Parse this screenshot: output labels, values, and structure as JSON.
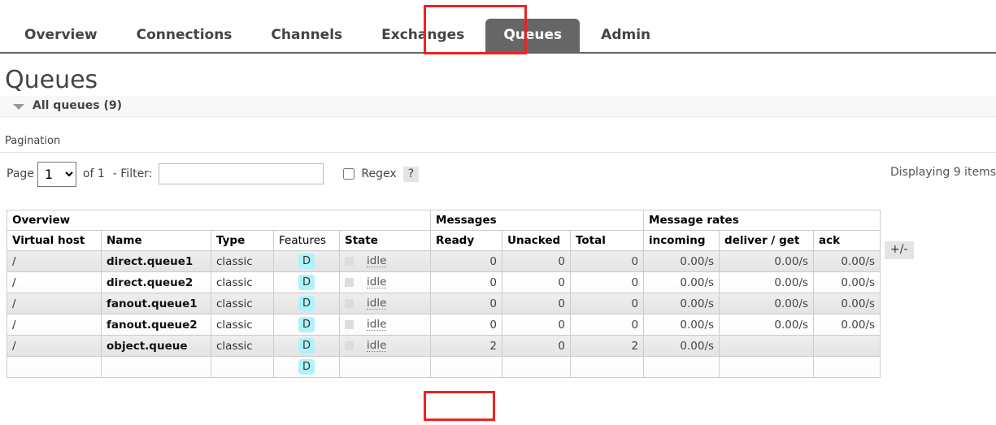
{
  "nav": {
    "items": [
      {
        "label": "Overview",
        "active": false
      },
      {
        "label": "Connections",
        "active": false
      },
      {
        "label": "Channels",
        "active": false
      },
      {
        "label": "Exchanges",
        "active": false
      },
      {
        "label": "Queues",
        "active": true
      },
      {
        "label": "Admin",
        "active": false
      }
    ]
  },
  "page": {
    "title": "Queues",
    "section_header": "All queues (9)",
    "pagination_label": "Pagination"
  },
  "pagination": {
    "page_label": "Page",
    "page_value": "1",
    "page_options": [
      "1"
    ],
    "of_label": "of 1",
    "filter_label": "- Filter:",
    "filter_value": "",
    "filter_placeholder": "",
    "regex_label": "Regex",
    "regex_checked": false,
    "help_label": "?",
    "displaying": "Displaying 9 items"
  },
  "table": {
    "group_headers": [
      {
        "label": "Overview",
        "span": 5
      },
      {
        "label": "Messages",
        "span": 3
      },
      {
        "label": "Message rates",
        "span": 3
      }
    ],
    "plusminus_label": "+/-",
    "columns": [
      {
        "label": "Virtual host",
        "sortable": true,
        "align": "left"
      },
      {
        "label": "Name",
        "sortable": true,
        "align": "left"
      },
      {
        "label": "Type",
        "sortable": true,
        "align": "left"
      },
      {
        "label": "Features",
        "sortable": false,
        "align": "left"
      },
      {
        "label": "State",
        "sortable": true,
        "align": "left"
      },
      {
        "label": "Ready",
        "sortable": true,
        "align": "left"
      },
      {
        "label": "Unacked",
        "sortable": true,
        "align": "left"
      },
      {
        "label": "Total",
        "sortable": true,
        "align": "left"
      },
      {
        "label": "incoming",
        "sortable": true,
        "align": "left"
      },
      {
        "label": "deliver / get",
        "sortable": true,
        "align": "left"
      },
      {
        "label": "ack",
        "sortable": true,
        "align": "left"
      }
    ],
    "rows": [
      {
        "vhost": "/",
        "name": "direct.queue1",
        "type": "classic",
        "features": "D",
        "state": "idle",
        "ready": "0",
        "unacked": "0",
        "total": "0",
        "incoming": "0.00/s",
        "deliver_get": "0.00/s",
        "ack": "0.00/s"
      },
      {
        "vhost": "/",
        "name": "direct.queue2",
        "type": "classic",
        "features": "D",
        "state": "idle",
        "ready": "0",
        "unacked": "0",
        "total": "0",
        "incoming": "0.00/s",
        "deliver_get": "0.00/s",
        "ack": "0.00/s"
      },
      {
        "vhost": "/",
        "name": "fanout.queue1",
        "type": "classic",
        "features": "D",
        "state": "idle",
        "ready": "0",
        "unacked": "0",
        "total": "0",
        "incoming": "0.00/s",
        "deliver_get": "0.00/s",
        "ack": "0.00/s"
      },
      {
        "vhost": "/",
        "name": "fanout.queue2",
        "type": "classic",
        "features": "D",
        "state": "idle",
        "ready": "0",
        "unacked": "0",
        "total": "0",
        "incoming": "0.00/s",
        "deliver_get": "0.00/s",
        "ack": "0.00/s"
      },
      {
        "vhost": "/",
        "name": "object.queue",
        "type": "classic",
        "features": "D",
        "state": "idle",
        "ready": "2",
        "unacked": "0",
        "total": "2",
        "incoming": "0.00/s",
        "deliver_get": "",
        "ack": ""
      },
      {
        "vhost": "",
        "name": "",
        "type": "",
        "features": "D",
        "state": "",
        "ready": "",
        "unacked": "",
        "total": "",
        "incoming": "",
        "deliver_get": "",
        "ack": ""
      }
    ]
  },
  "annotations": {
    "accent_color": "#f02222",
    "highlight_queues_tab": true,
    "highlight_ready_cell": true
  }
}
